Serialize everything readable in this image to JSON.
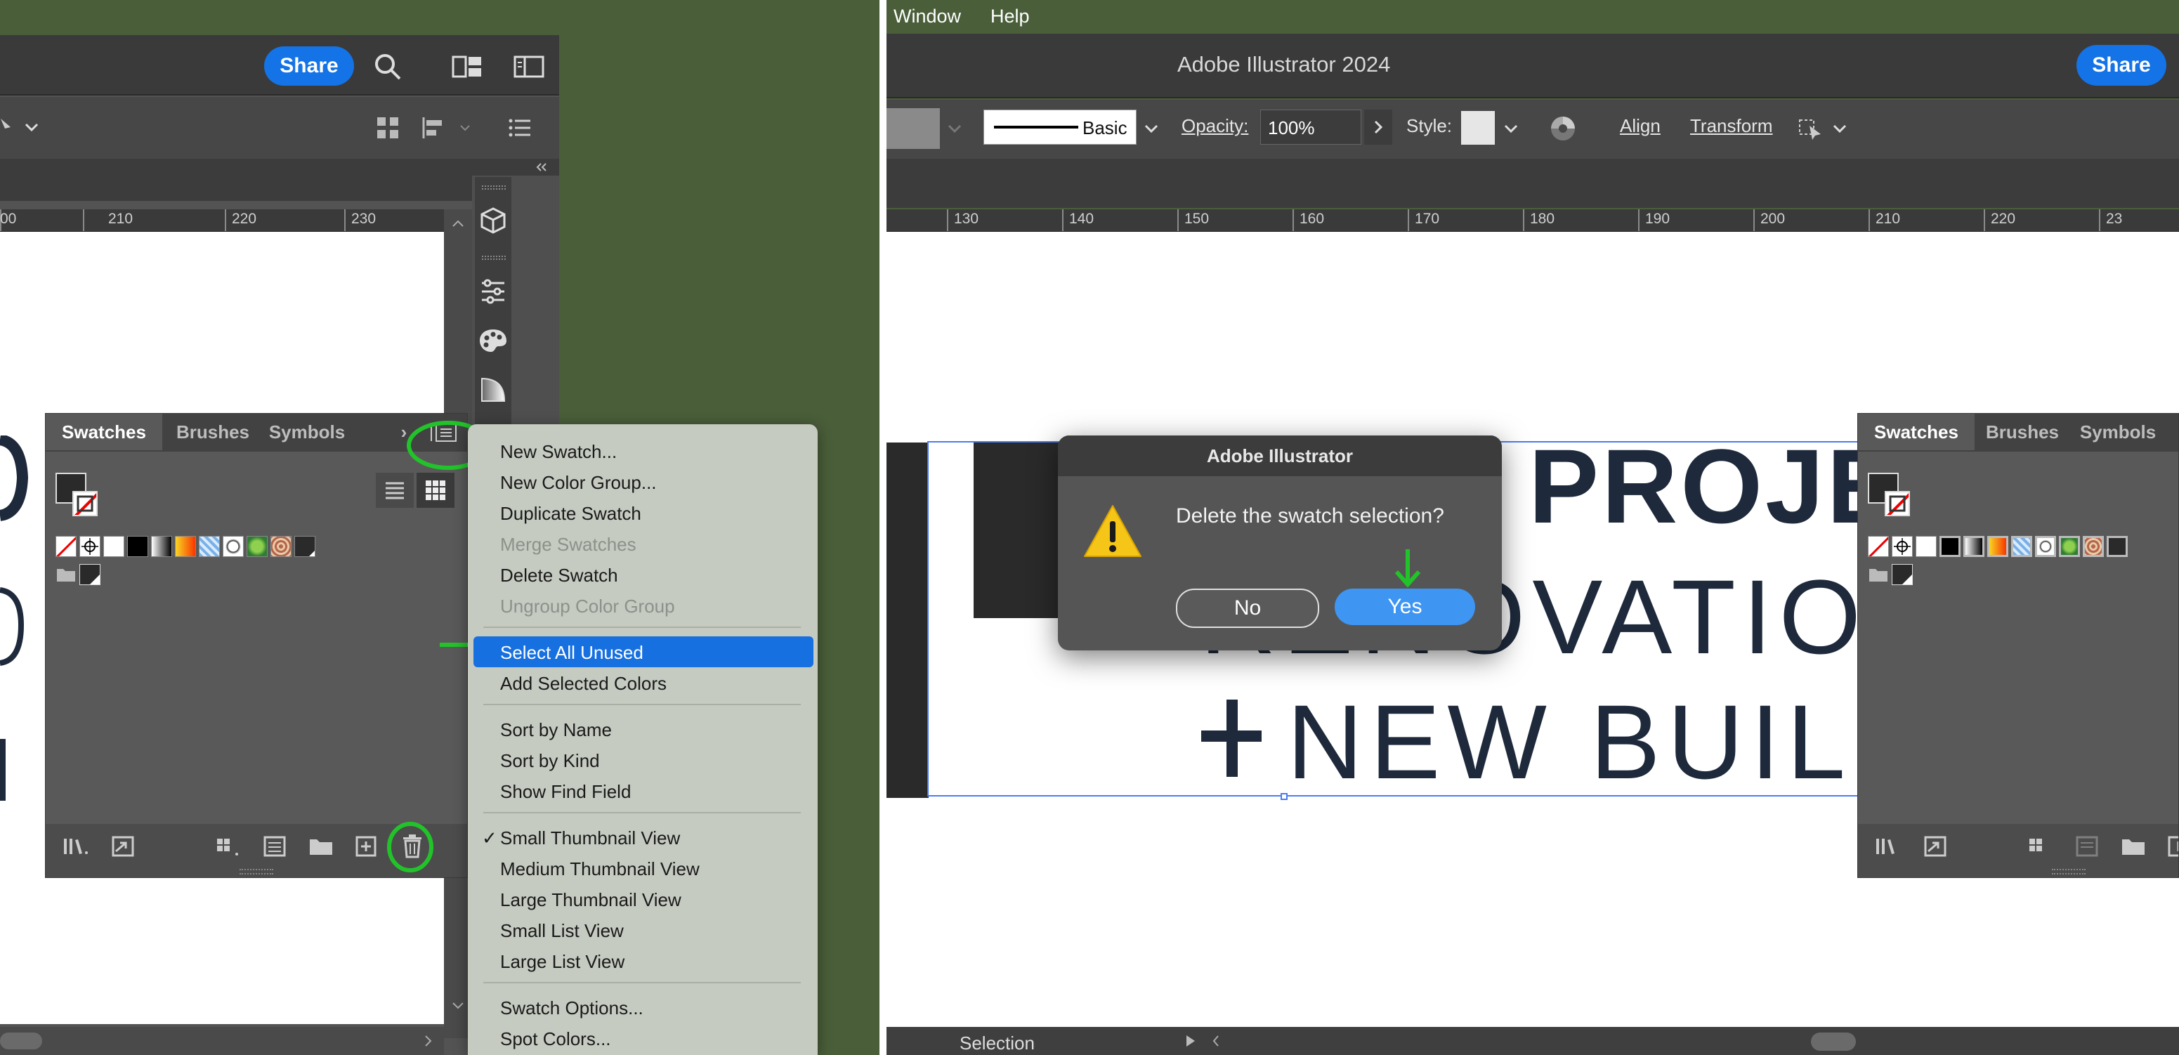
{
  "left": {
    "share_label": "Share",
    "ruler_labels": [
      "00",
      "210",
      "220",
      "230"
    ],
    "panel": {
      "tabs": [
        "Swatches",
        "Brushes",
        "Symbols"
      ],
      "overflow_symbol": "›"
    },
    "menu": {
      "groups": [
        [
          {
            "label": "New Swatch...",
            "enabled": true
          },
          {
            "label": "New Color Group...",
            "enabled": true
          },
          {
            "label": "Duplicate Swatch",
            "enabled": true
          },
          {
            "label": "Merge Swatches",
            "enabled": false
          },
          {
            "label": "Delete Swatch",
            "enabled": true
          },
          {
            "label": "Ungroup Color Group",
            "enabled": false
          }
        ],
        [
          {
            "label": "Select All Unused",
            "enabled": true,
            "selected": true
          },
          {
            "label": "Add Selected Colors",
            "enabled": true
          }
        ],
        [
          {
            "label": "Sort by Name",
            "enabled": true
          },
          {
            "label": "Sort by Kind",
            "enabled": true
          },
          {
            "label": "Show Find Field",
            "enabled": true
          }
        ],
        [
          {
            "label": "Small Thumbnail View",
            "enabled": true,
            "checked": true
          },
          {
            "label": "Medium Thumbnail View",
            "enabled": true
          },
          {
            "label": "Large Thumbnail View",
            "enabled": true
          },
          {
            "label": "Small List View",
            "enabled": true
          },
          {
            "label": "Large List View",
            "enabled": true
          }
        ],
        [
          {
            "label": "Swatch Options...",
            "enabled": true
          },
          {
            "label": "Spot Colors...",
            "enabled": true
          }
        ]
      ],
      "checkmark": "✓"
    }
  },
  "right": {
    "menubar": [
      "Window",
      "Help"
    ],
    "app_title": "Adobe Illustrator 2024",
    "share_label": "Share",
    "control_bar": {
      "stroke_profile": "Basic",
      "opacity_label": "Opacity:",
      "opacity_value": "100%",
      "style_label": "Style:",
      "align_label": "Align",
      "transform_label": "Transform"
    },
    "ruler_labels": [
      "130",
      "140",
      "150",
      "160",
      "170",
      "180",
      "190",
      "200",
      "210",
      "220",
      "23"
    ],
    "canvas_text": {
      "line1": "PROJEC",
      "line2": "RENOVATIO",
      "line3": "NEW BUIL"
    },
    "dialog": {
      "title": "Adobe Illustrator",
      "message": "Delete the swatch selection?",
      "no_label": "No",
      "yes_label": "Yes"
    },
    "panel": {
      "tabs": [
        "Swatches",
        "Brushes",
        "Symbols"
      ]
    },
    "status_label": "Selection"
  },
  "colors": {
    "accent": "#1473e6",
    "annotation_green": "#22c32a",
    "menu_highlight": "#1770e0",
    "desktop": "#4a5e3a"
  }
}
